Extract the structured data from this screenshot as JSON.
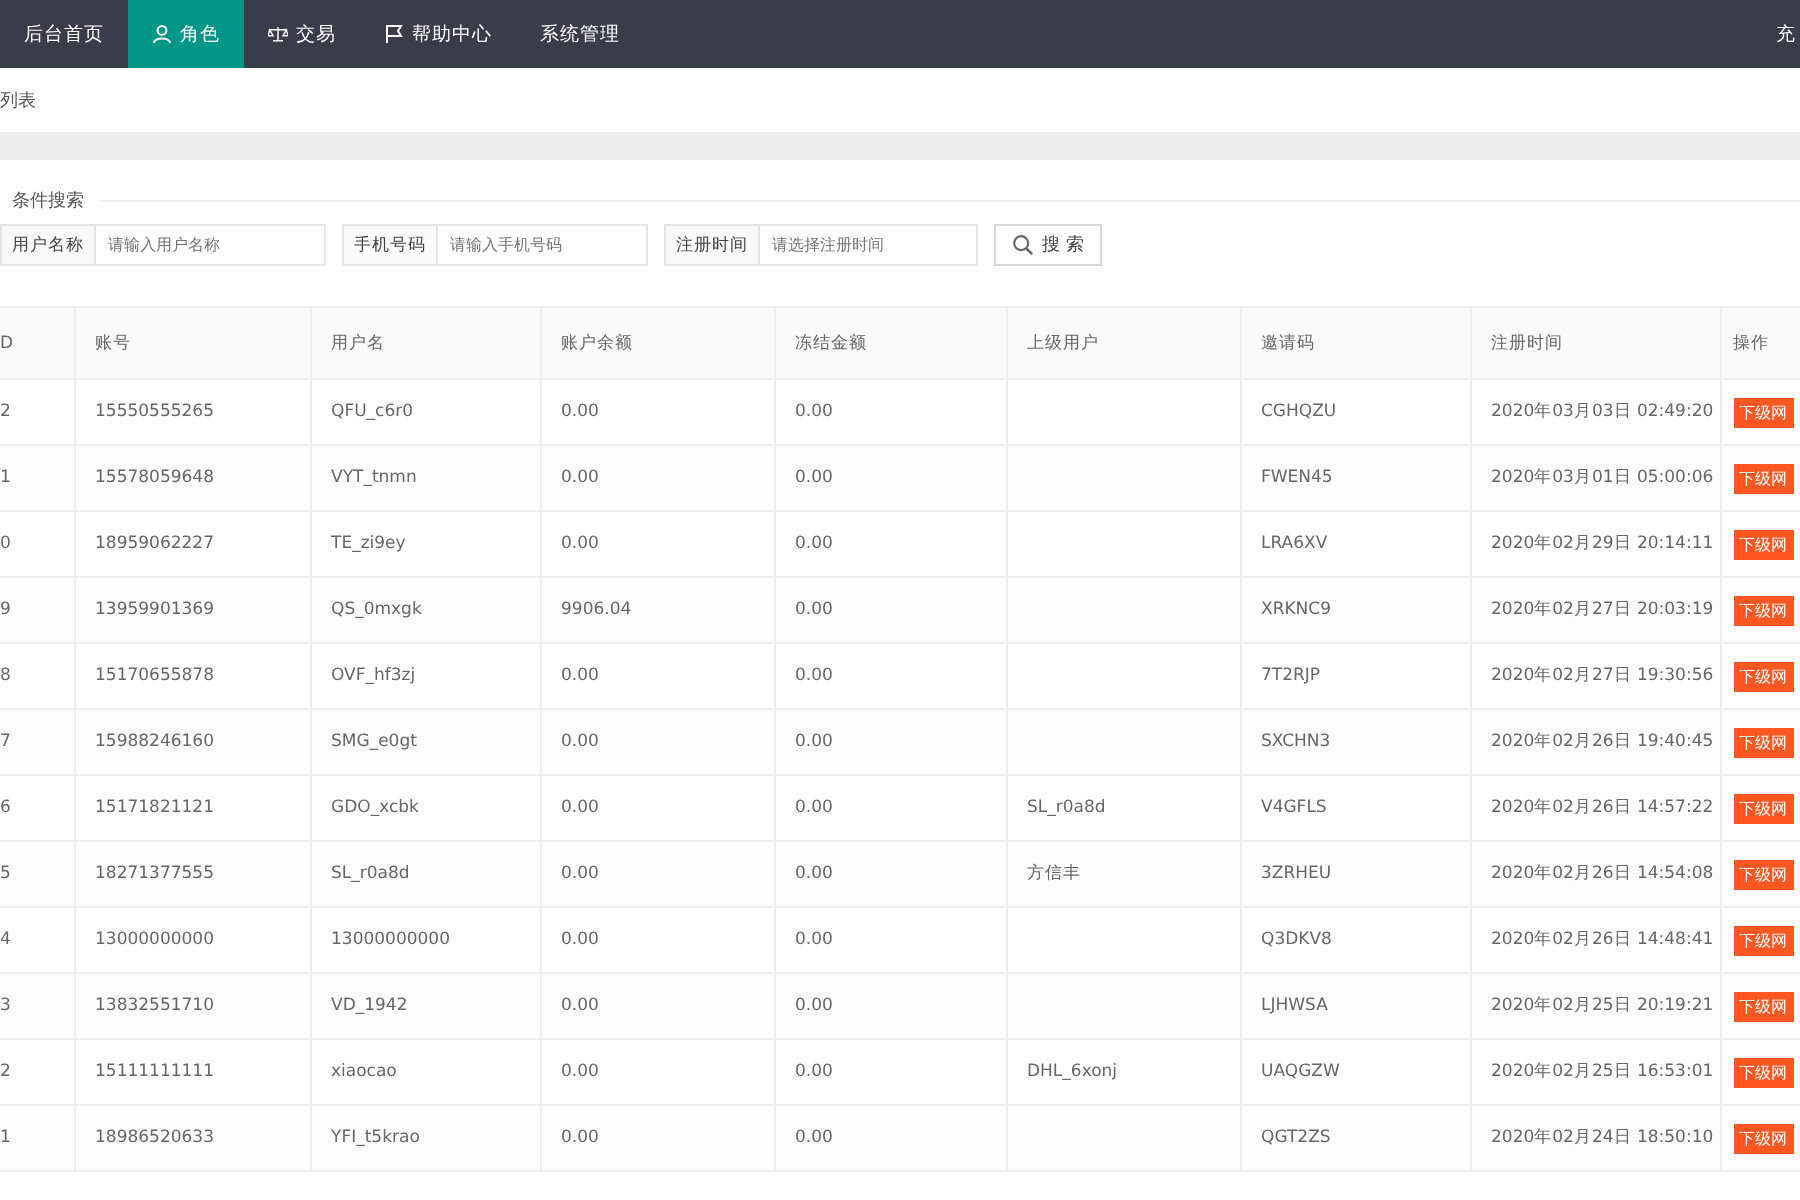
{
  "nav": {
    "items": [
      {
        "label": "后台首页",
        "kind": "plain",
        "selected": false
      },
      {
        "label": "角色",
        "kind": "person",
        "selected": true
      },
      {
        "label": "交易",
        "kind": "scale",
        "selected": false
      },
      {
        "label": "帮助中心",
        "kind": "flag",
        "selected": false
      },
      {
        "label": "系统管理",
        "kind": "plain",
        "selected": false
      }
    ],
    "right_text": "充"
  },
  "breadcrumb": "列表",
  "search": {
    "legend": "条件搜索",
    "fields": [
      {
        "label": "用户名称",
        "placeholder": "请输入用户名称"
      },
      {
        "label": "手机号码",
        "placeholder": "请输入手机号码"
      },
      {
        "label": "注册时间",
        "placeholder": "请选择注册时间"
      }
    ],
    "button": "搜 索"
  },
  "table": {
    "columns": [
      "D",
      "账号",
      "用户名",
      "账户余额",
      "冻结金额",
      "上级用户",
      "邀请码",
      "注册时间",
      "操作"
    ],
    "rows": [
      [
        "2",
        "15550555265",
        "QFU_c6r0",
        "0.00",
        "0.00",
        "",
        "CGHQZU",
        "2020年03月03日 02:49:20",
        "下级网"
      ],
      [
        "1",
        "15578059648",
        "VYT_tnmn",
        "0.00",
        "0.00",
        "",
        "FWEN45",
        "2020年03月01日 05:00:06",
        "下级网"
      ],
      [
        "0",
        "18959062227",
        "TE_zi9ey",
        "0.00",
        "0.00",
        "",
        "LRA6XV",
        "2020年02月29日 20:14:11",
        "下级网"
      ],
      [
        "9",
        "13959901369",
        "QS_0mxgk",
        "9906.04",
        "0.00",
        "",
        "XRKNC9",
        "2020年02月27日 20:03:19",
        "下级网"
      ],
      [
        "8",
        "15170655878",
        "OVF_hf3zj",
        "0.00",
        "0.00",
        "",
        "7T2RJP",
        "2020年02月27日 19:30:56",
        "下级网"
      ],
      [
        "7",
        "15988246160",
        "SMG_e0gt",
        "0.00",
        "0.00",
        "",
        "SXCHN3",
        "2020年02月26日 19:40:45",
        "下级网"
      ],
      [
        "6",
        "15171821121",
        "GDO_xcbk",
        "0.00",
        "0.00",
        "SL_r0a8d",
        "V4GFLS",
        "2020年02月26日 14:57:22",
        "下级网"
      ],
      [
        "5",
        "18271377555",
        "SL_r0a8d",
        "0.00",
        "0.00",
        "方信丰",
        "3ZRHEU",
        "2020年02月26日 14:54:08",
        "下级网"
      ],
      [
        "4",
        "13000000000",
        "13000000000",
        "0.00",
        "0.00",
        "",
        "Q3DKV8",
        "2020年02月26日 14:48:41",
        "下级网"
      ],
      [
        "3",
        "13832551710",
        "VD_1942",
        "0.00",
        "0.00",
        "",
        "LJHWSA",
        "2020年02月25日 20:19:21",
        "下级网"
      ],
      [
        "2",
        "15111111111",
        "xiaocao",
        "0.00",
        "0.00",
        "DHL_6xonj",
        "UAQGZW",
        "2020年02月25日 16:53:01",
        "下级网"
      ],
      [
        "1",
        "18986520633",
        "YFI_t5krao",
        "0.00",
        "0.00",
        "",
        "QGT2ZS",
        "2020年02月24日 18:50:10",
        "下级网"
      ]
    ]
  }
}
